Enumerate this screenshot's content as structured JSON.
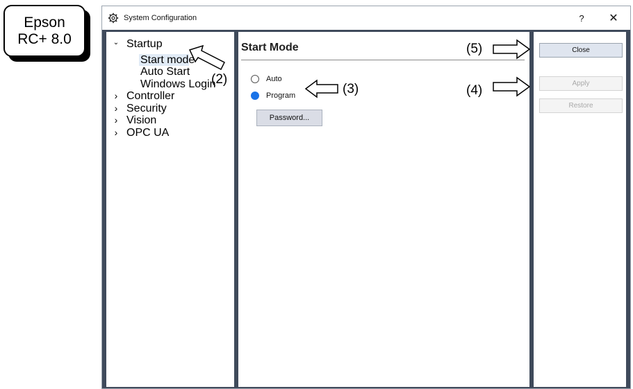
{
  "badge": {
    "line1": "Epson",
    "line2": "RC+ 8.0"
  },
  "window": {
    "title": "System Configuration",
    "help_glyph": "?",
    "close_glyph": "✕",
    "icon": "gear-icon"
  },
  "tree": {
    "items": [
      {
        "label": "Startup",
        "expanded": true,
        "chevron": "⌄"
      },
      {
        "label": "Start mode",
        "selected": true
      },
      {
        "label": "Auto Start"
      },
      {
        "label": "Windows Login"
      },
      {
        "label": "Controller",
        "chevron": "›"
      },
      {
        "label": "Security",
        "chevron": "›"
      },
      {
        "label": "Vision",
        "chevron": "›"
      },
      {
        "label": "OPC UA",
        "chevron": "›"
      }
    ]
  },
  "content": {
    "title": "Start Mode",
    "options": [
      {
        "label": "Auto",
        "checked": false
      },
      {
        "label": "Program",
        "checked": true
      }
    ],
    "password_button": "Password..."
  },
  "buttons": {
    "close": "Close",
    "apply": "Apply",
    "restore": "Restore"
  },
  "annotations": {
    "a2": "(2)",
    "a3": "(3)",
    "a4": "(4)",
    "a5": "(5)"
  },
  "colors": {
    "window_frame": "#3f4a5b",
    "radio_selected": "#1a73e8",
    "tree_selection": "#e1ebf6"
  }
}
